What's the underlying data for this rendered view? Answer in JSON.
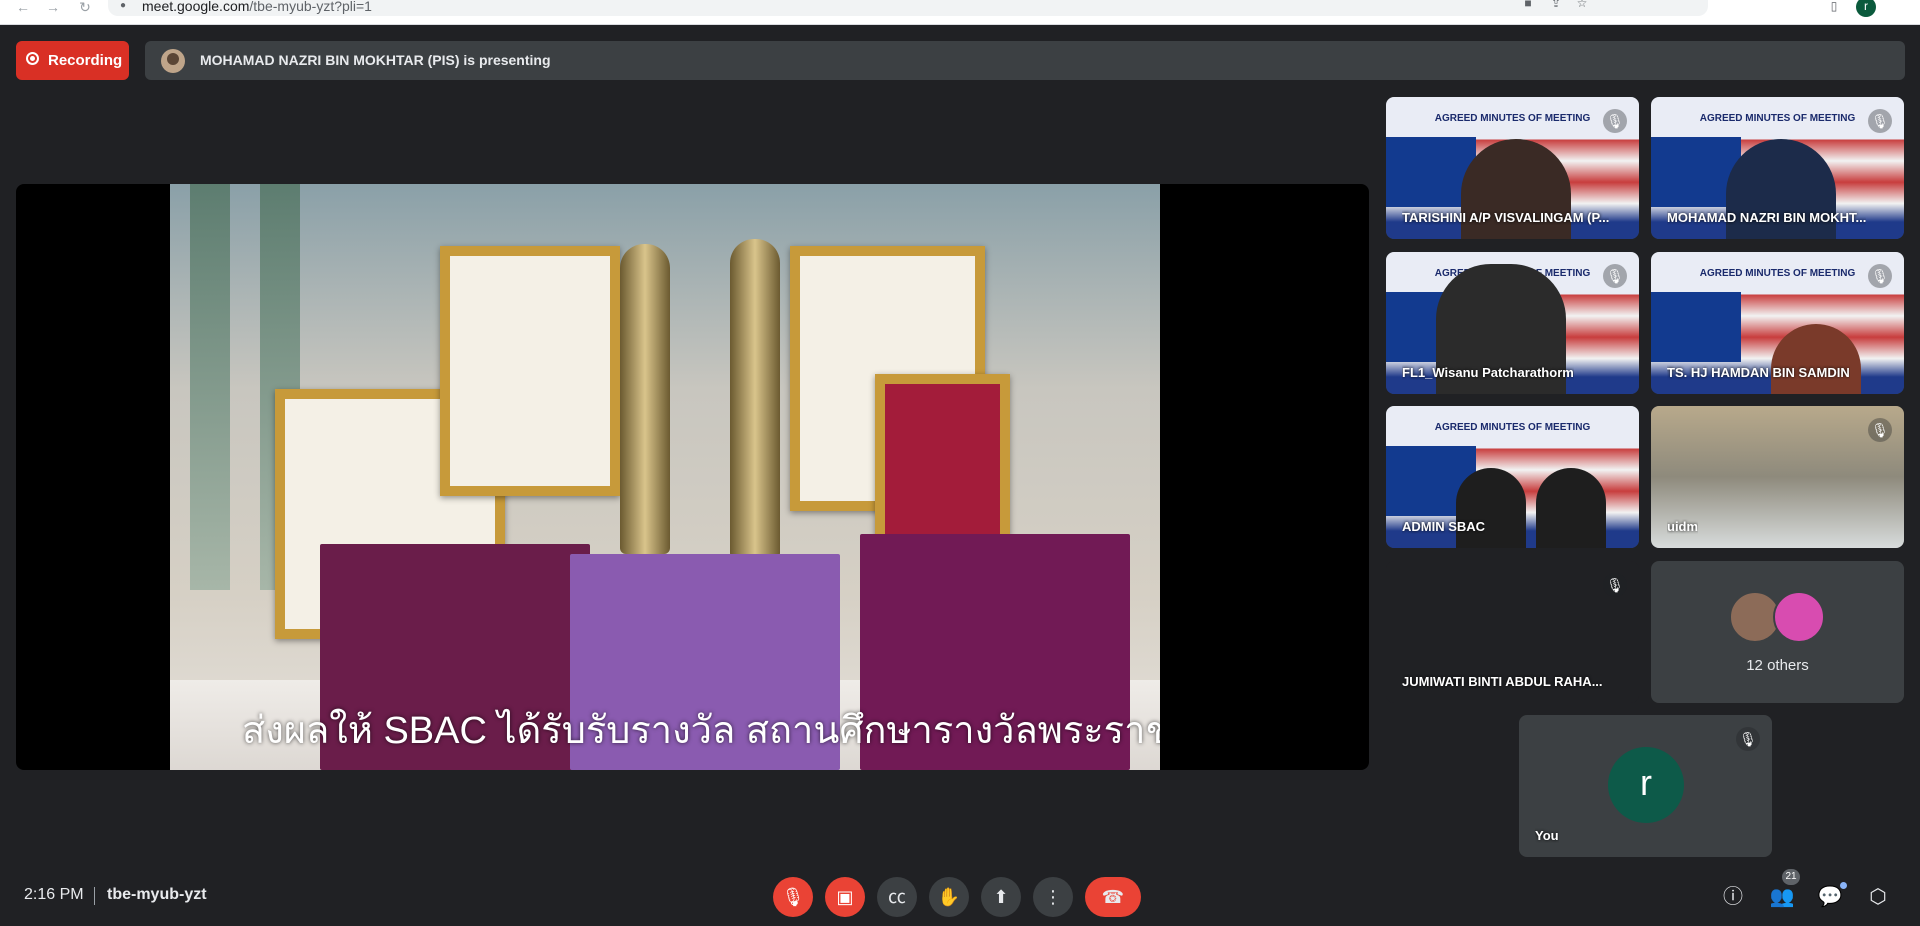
{
  "browser": {
    "url_host": "meet.google.com",
    "url_path": "/tbe-myub-yzt?pli=1",
    "profile_initial": "r"
  },
  "header": {
    "recording_label": "Recording",
    "presenting_text": "MOHAMAD NAZRI BIN MOKHTAR (PIS) is presenting"
  },
  "presentation": {
    "caption": "ส่งผลให้ SBAC ได้รับรับรางวัล สถานศึกษารางวัลพระราชทาน"
  },
  "tiles": [
    {
      "name": "TARISHINI A/P VISVALINGAM (P...",
      "heading": "AGREED MINUTES OF MEETING",
      "muted": true
    },
    {
      "name": "MOHAMAD NAZRI BIN MOKHT...",
      "heading": "AGREED MINUTES OF MEETING",
      "muted": true
    },
    {
      "name": "FL1_Wisanu Patcharathorm",
      "heading": "AGREED MINUTES OF MEETING",
      "muted": true
    },
    {
      "name": "TS. HJ HAMDAN BIN SAMDIN",
      "heading": "AGREED MINUTES OF MEETING",
      "muted": true
    },
    {
      "name": "ADMIN SBAC",
      "heading": "AGREED MINUTES OF MEETING",
      "muted": false
    },
    {
      "name": "uidm",
      "muted": true
    },
    {
      "name": "JUMIWATI BINTI ABDUL RAHA...",
      "muted": true
    },
    {
      "others_label": "12 others"
    },
    {
      "name": "You",
      "avatar_letter": "r",
      "muted": true
    }
  ],
  "bottom_bar": {
    "time": "2:16 PM",
    "meeting_code": "tbe-myub-yzt",
    "people_count": "21"
  },
  "colors": {
    "accent_red": "#ea4335",
    "background": "#202124",
    "tile_bg": "#3c4043"
  }
}
